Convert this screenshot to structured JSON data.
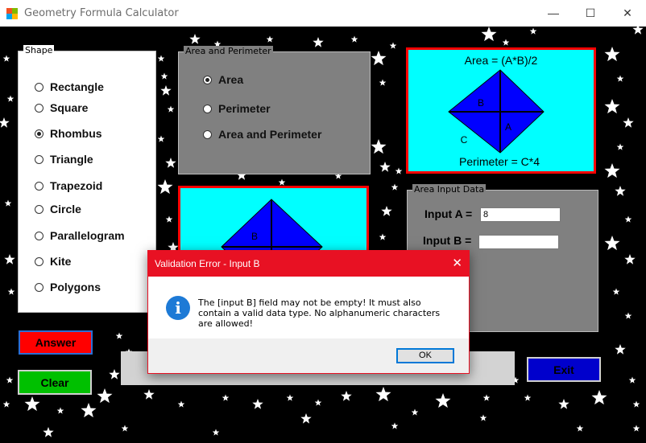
{
  "window": {
    "title": "Geometry Formula Calculator",
    "minimize_glyph": "—",
    "maximize_glyph": "☐",
    "close_glyph": "✕"
  },
  "shape_group": {
    "title": "Shape",
    "options": [
      {
        "label": "Rectangle",
        "selected": false
      },
      {
        "label": "Square",
        "selected": false
      },
      {
        "label": "Rhombus",
        "selected": true
      },
      {
        "label": "Triangle",
        "selected": false
      },
      {
        "label": "Trapezoid",
        "selected": false
      },
      {
        "label": "Circle",
        "selected": false
      },
      {
        "label": "Parallelogram",
        "selected": false
      },
      {
        "label": "Kite",
        "selected": false
      },
      {
        "label": "Polygons",
        "selected": false
      }
    ]
  },
  "calc_group": {
    "title": "Area and Perimeter",
    "options": [
      {
        "label": "Area",
        "selected": true
      },
      {
        "label": "Perimeter",
        "selected": false
      },
      {
        "label": "Area and Perimeter",
        "selected": false
      }
    ]
  },
  "formula_diagram": {
    "area_formula": "Area = (A*B)/2",
    "perimeter_formula": "Perimeter = C*4",
    "label_a": "A",
    "label_b": "B",
    "label_c": "C"
  },
  "preview_diagram": {
    "label_b": "B"
  },
  "input_group": {
    "title": "Area Input Data",
    "input_a_label": "Input A =",
    "input_a_value": "8",
    "input_b_label": "Input B =",
    "input_b_value": ""
  },
  "buttons": {
    "answer": "Answer",
    "clear": "Clear",
    "exit": "Exit"
  },
  "dialog": {
    "title": "Validation Error - Input B",
    "close_glyph": "✕",
    "icon_glyph": "i",
    "message": "The [input B] field may not be empty! It must also contain a valid data type. No alphanumeric characters are allowed!",
    "ok_label": "OK"
  },
  "colors": {
    "diagram_background": "#00ffff",
    "diagram_border": "#ff0000",
    "rhombus_fill": "#0000ff",
    "answer_button": "#ff0000",
    "clear_button": "#00c000",
    "exit_button": "#0000cc",
    "dialog_accent": "#e81123",
    "info_icon": "#1d7ad6"
  }
}
